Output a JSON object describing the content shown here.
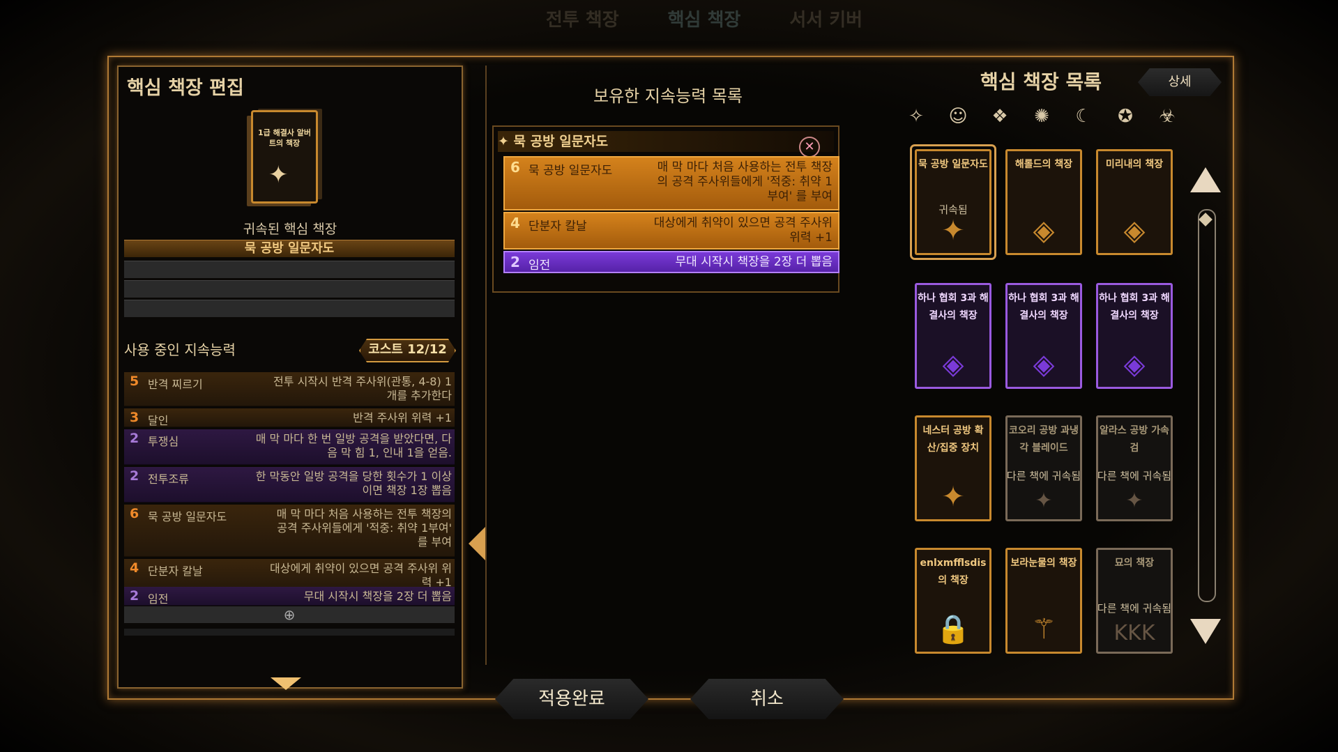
{
  "topnav": [
    "전투 책장",
    "핵심 책장",
    "서서 키버"
  ],
  "left": {
    "title": "핵심 책장 편집",
    "book_title": "1급 해결사 알버트의 책장",
    "attached_label": "귀속된 핵심 책장",
    "attached_name": "묵 공방 일문자도",
    "using_header": "사용 중인 지속능력",
    "cost": "코스트  12/12",
    "abilities": [
      {
        "cost": "5",
        "name": "반격 찌르기",
        "desc": "전투 시작시 반격 주사위(관통, 4-8) 1개를 추가한다",
        "color": "or"
      },
      {
        "cost": "3",
        "name": "달인",
        "desc": "반격 주사위 위력 +1",
        "color": "or"
      },
      {
        "cost": "2",
        "name": "투쟁심",
        "desc": "매 막 마다 한 번 일방 공격을 받았다면, 다음 막 힘 1, 인내 1을 얻음.",
        "color": "pu"
      },
      {
        "cost": "2",
        "name": "전투조류",
        "desc": "한 막동안 일방 공격을 당한 횟수가 1 이상이면 책장 1장 뽑음",
        "color": "pu"
      },
      {
        "cost": "6",
        "name": "묵 공방 일문자도",
        "desc": "매 막 마다 처음 사용하는 전투 책장의 공격 주사위들에게 '적중: 취약 1부여' 를 부여",
        "color": "or"
      },
      {
        "cost": "4",
        "name": "단분자 칼날",
        "desc": "대상에게 취약이 있으면 공격 주사위 위력 +1",
        "color": "or"
      },
      {
        "cost": "2",
        "name": "임전",
        "desc": "무대 시작시 책장을 2장 더 뽑음",
        "color": "pu"
      }
    ],
    "plus": "⊕"
  },
  "middle": {
    "title": "보유한 지속능력 목록",
    "group_name": "묵 공방 일문자도",
    "close": "✕",
    "abilities": [
      {
        "cost": "6",
        "name": "묵 공방 일문자도",
        "desc": "매 막 마다 처음 사용하는 전투 책장의 공격 주사위들에게 '적중: 취약 1부여' 를 부여",
        "color": "or"
      },
      {
        "cost": "4",
        "name": "단분자 칼날",
        "desc": "대상에게 취약이 있으면 공격 주사위 위력 +1",
        "color": "or"
      },
      {
        "cost": "2",
        "name": "임전",
        "desc": "무대 시작시 책장을 2장 더 뽑음",
        "color": "pu"
      }
    ]
  },
  "buttons": {
    "apply": "적용완료",
    "cancel": "취소"
  },
  "right": {
    "title": "핵심 책장 목록",
    "detail": "상세",
    "filters": [
      "✧",
      "☺",
      "❖",
      "✺",
      "☾",
      "✪",
      "☣"
    ],
    "cards": [
      {
        "title": "묵 공방 일문자도",
        "sub": "귀속됨",
        "emblem": "✦",
        "style": "or sel"
      },
      {
        "title": "해롤드의 책장",
        "sub": "",
        "emblem": "◈",
        "style": "or"
      },
      {
        "title": "미리내의 책장",
        "sub": "",
        "emblem": "◈",
        "style": "or"
      },
      {
        "title": "하나 협회 3과 해결사의 책장",
        "sub": "",
        "emblem": "◈",
        "style": "pu"
      },
      {
        "title": "하나 협회 3과 해결사의 책장",
        "sub": "",
        "emblem": "◈",
        "style": "pu"
      },
      {
        "title": "하나 협회 3과 해결사의 책장",
        "sub": "",
        "emblem": "◈",
        "style": "pu"
      },
      {
        "title": "네스터 공방 확산/집중 장치",
        "sub": "",
        "emblem": "✦",
        "style": "or"
      },
      {
        "title": "코오리 공방 과냉각 블레이드",
        "sub": "다른 책에 귀속됨",
        "emblem": "✦",
        "style": "gr"
      },
      {
        "title": "알라스 공방 가속검",
        "sub": "다른 책에 귀속됨",
        "emblem": "✦",
        "style": "gr"
      },
      {
        "title": "enlxmfflsdis의 책장",
        "sub": "",
        "emblem": "🔒",
        "style": "or"
      },
      {
        "title": "보라눈물의 책장",
        "sub": "",
        "emblem": "⚚",
        "style": "or"
      },
      {
        "title": "묘의 책장",
        "sub": "다른 책에 귀속됨",
        "emblem": "KKK",
        "style": "gr"
      }
    ]
  },
  "colors": {
    "accent": "#c8892e",
    "purple": "#7a3ad8",
    "orange_row": "#d4821c"
  }
}
